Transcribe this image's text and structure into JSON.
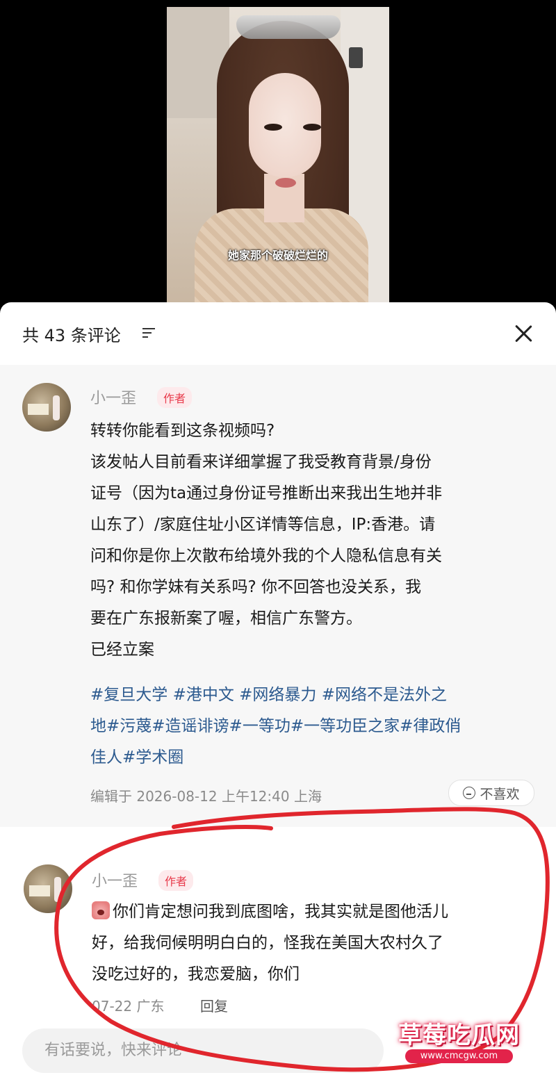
{
  "video": {
    "subtitle": "她家那个破破烂烂的"
  },
  "header": {
    "comment_count": "共 43 条评论"
  },
  "pinned_comment": {
    "username": "小一歪",
    "badge": "作者",
    "lines": [
      "转转你能看到这条视频吗?",
      "该发帖人目前看来详细掌握了我受教育背景/身份",
      "证号（因为ta通过身份证号推断出来我出生地并非",
      "山东了）/家庭住址小区详情等信息，IP:香港。请",
      "问和你是你上次散布给境外我的个人隐私信息有关",
      "吗?   和你学妹有关系吗? 你不回答也没关系，我",
      "要在广东报新案了喔，相信广东警方。",
      "已经立案"
    ],
    "hashtag_lines": [
      "#复旦大学 #港中文 #网络暴力 #网络不是法外之",
      "地#污蔑#造谣诽谤#一等功#一等功臣之家#律政俏",
      "佳人#学术圈"
    ],
    "meta": "编辑于  2026-08-12 上午12:40 上海",
    "dislike_label": "不喜欢"
  },
  "second_comment": {
    "username": "小一歪",
    "badge": "作者",
    "lines": [
      "你们肯定想问我到底图啥，我其实就是图他活儿",
      "好，给我伺候明明白白的，怪我在美国大农村久了",
      "没吃过好的，我恋爱脑，你们"
    ],
    "date_location": "07-22 广东",
    "reply_label": "回复"
  },
  "input": {
    "placeholder": "有话要说，快来评论"
  },
  "watermark": {
    "title": "草莓吃瓜网",
    "url": "www.cmcgw.com"
  },
  "colors": {
    "annotation": "#e0262d",
    "author_badge": "#e8394a",
    "hashtag": "#2c5a8f"
  }
}
